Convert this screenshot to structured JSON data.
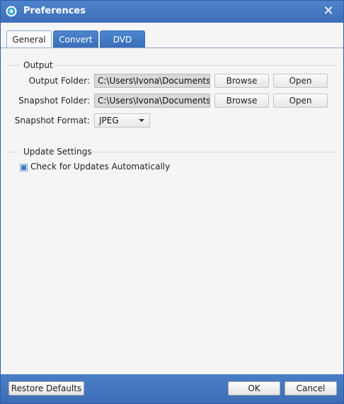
{
  "window": {
    "title": "Preferences"
  },
  "tabs": [
    {
      "label": "General",
      "active": true
    },
    {
      "label": "Convert",
      "active": false
    },
    {
      "label": "DVD",
      "active": false
    }
  ],
  "output": {
    "group_title": "Output",
    "output_folder_label": "Output Folder:",
    "output_folder_value": "C:\\Users\\Ivona\\Documents",
    "snapshot_folder_label": "Snapshot Folder:",
    "snapshot_folder_value": "C:\\Users\\Ivona\\Documents",
    "browse_label": "Browse",
    "open_label": "Open",
    "snapshot_format_label": "Snapshot Format:",
    "snapshot_format_value": "JPEG"
  },
  "update": {
    "group_title": "Update Settings",
    "check_label": "Check for Updates Automatically",
    "checked": true
  },
  "footer": {
    "restore_label": "Restore Defaults",
    "ok_label": "OK",
    "cancel_label": "Cancel"
  },
  "colors": {
    "titlebar": "#4275bd",
    "tab_active_bg": "#ffffff",
    "tab_inactive_bg": "#4479c2",
    "content_bg": "#f5f5f5",
    "footer_bg": "#4275bd"
  }
}
